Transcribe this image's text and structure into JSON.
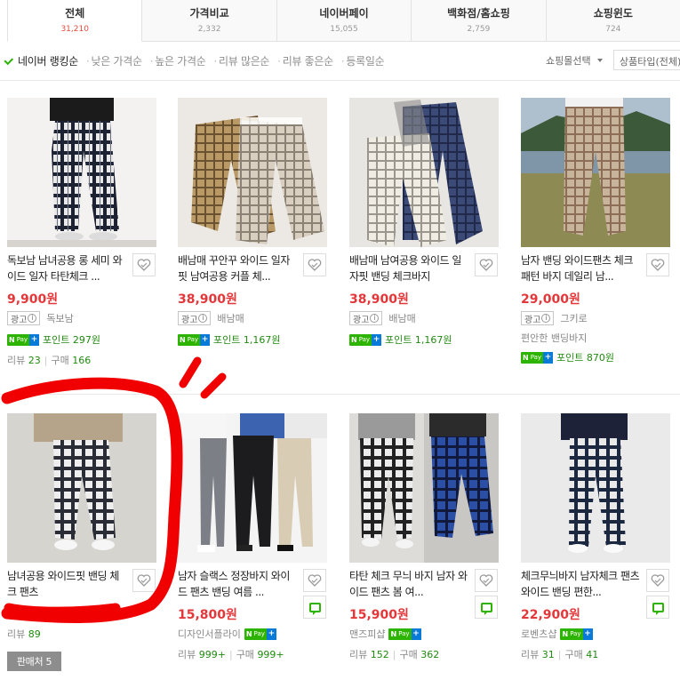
{
  "tabs": [
    {
      "name": "전체",
      "count": "31,210",
      "active": true
    },
    {
      "name": "가격비교",
      "count": "2,332"
    },
    {
      "name": "네이버페이",
      "count": "15,055"
    },
    {
      "name": "백화점/홈쇼핑",
      "count": "2,759"
    },
    {
      "name": "쇼핑윈도",
      "count": "724"
    }
  ],
  "sort": {
    "items": [
      "네이버 랭킹순",
      "낮은 가격순",
      "높은 가격순",
      "리뷰 많은순",
      "리뷰 좋은순",
      "등록일순"
    ],
    "mall_filter": "쇼핑몰선택",
    "type_filter": "상품타입(전체)"
  },
  "labels": {
    "ad": "광고",
    "info": "i",
    "npay_n": "N",
    "npay_pay": "Pay",
    "npay_plus": "+",
    "review": "리뷰",
    "purchase": "구매"
  },
  "products": [
    {
      "title": "독보남 남녀공용 롱 세미 와이드 일자 타탄체크 ...",
      "price": "9,900원",
      "ad": true,
      "mall": "독보남",
      "point": "포인트 297원",
      "review": "23",
      "purchase": "166"
    },
    {
      "title": "배남매 꾸안꾸 와이드 일자핏 남여공용 커플 체...",
      "price": "38,900원",
      "ad": true,
      "mall": "배남매",
      "point": "포인트 1,167원"
    },
    {
      "title": "배남매 남여공용 와이드 일자핏 밴딩 체크바지",
      "price": "38,900원",
      "ad": true,
      "mall": "배남매",
      "point": "포인트 1,167원"
    },
    {
      "title": "남자 밴딩 와이드팬츠 체크패턴 바지 데일리 남...",
      "price": "29,000원",
      "ad": true,
      "mall": "그키로",
      "extra": "편안한 밴딩바지",
      "point": "포인트 870원"
    },
    {
      "title": "남녀공용 와이드핏 밴딩 체크 팬츠",
      "price": "",
      "review": "89",
      "store_count": "판매처 5"
    },
    {
      "title": "남자 슬랙스 정장바지 와이드 팬츠 밴딩 여름 ...",
      "price": "15,800원",
      "mall": "디자인서플라이",
      "review": "999+",
      "purchase": "999+"
    },
    {
      "title": "타탄 체크 무늬 바지 남자 와이드 팬츠 봄 여...",
      "price": "15,900원",
      "mall": "맨즈피샵",
      "review": "152",
      "purchase": "362"
    },
    {
      "title": "체크무늬바지 남자체크 팬츠 와이드 밴딩 편한...",
      "price": "22,900원",
      "mall": "로벤츠샵",
      "review": "31",
      "purchase": "41"
    }
  ],
  "colors": {
    "accent_green": "#2db400",
    "price_red": "#e4373a",
    "npay_blue": "#0a7ad9",
    "scribble_red": "#f00000"
  }
}
